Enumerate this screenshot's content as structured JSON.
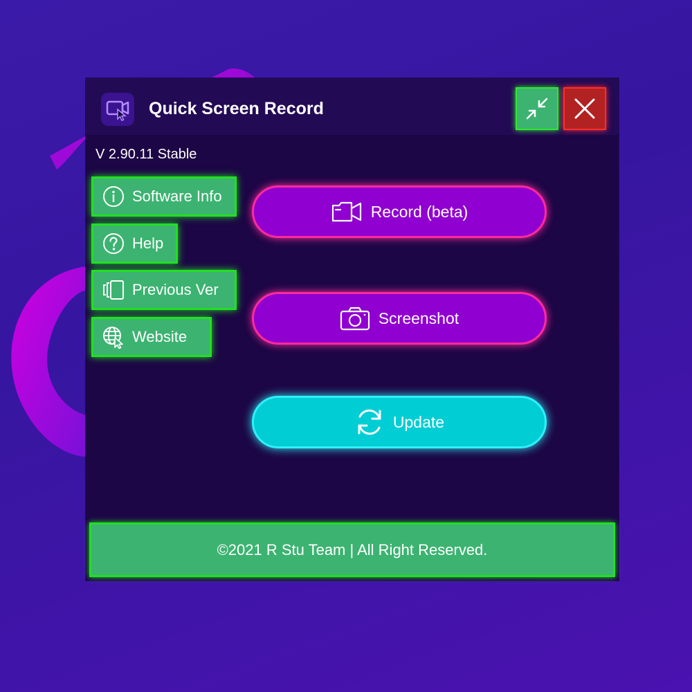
{
  "app": {
    "title": "Quick Screen Record",
    "version": "V 2.90.11 Stable"
  },
  "window_controls": {
    "minimize_icon": "collapse-arrows-icon",
    "close_icon": "close-icon"
  },
  "sidebar": {
    "items": [
      {
        "label": "Software Info",
        "icon": "info-icon"
      },
      {
        "label": "Help",
        "icon": "help-icon"
      },
      {
        "label": "Previous Ver",
        "icon": "versions-icon"
      },
      {
        "label": "Website",
        "icon": "globe-cursor-icon"
      }
    ]
  },
  "actions": {
    "record_label": "Record (beta)",
    "screenshot_label": "Screenshot",
    "update_label": "Update"
  },
  "footer": {
    "text": "©2021  R Stu Team | All Right Reserved."
  },
  "colors": {
    "background": "#3a1aa8",
    "window": "#1c0645",
    "green": "#3cb371",
    "neon_green": "#22e022",
    "purple": "#9000d0",
    "pink_glow": "#ff2a9e",
    "cyan": "#00cdd4",
    "close_red": "#b22222"
  }
}
